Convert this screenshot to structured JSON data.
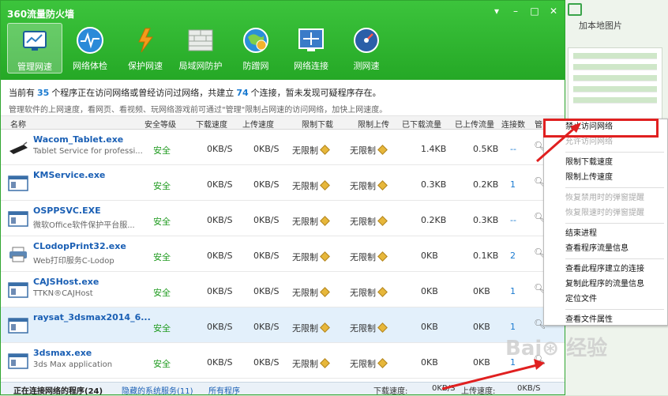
{
  "bg_right": {
    "label": "加本地图片"
  },
  "app": {
    "title": "360流量防火墙",
    "controls": [
      "▾",
      "–",
      "□",
      "✕"
    ]
  },
  "toolbar": [
    {
      "label": "管理网速",
      "icon": "monitor-icon",
      "active": true,
      "color": "#2e7fc4"
    },
    {
      "label": "网络体检",
      "icon": "pulse-icon",
      "active": false,
      "color": "#2a8ad8"
    },
    {
      "label": "保护网速",
      "icon": "lightning-shield-icon",
      "active": false,
      "color": "#f39b1a"
    },
    {
      "label": "局域网防护",
      "icon": "brick-wall-icon",
      "active": false,
      "color": "#d4dad4"
    },
    {
      "label": "防蹭网",
      "icon": "globe-icon",
      "active": false,
      "color": "#2b8fd8"
    },
    {
      "label": "网络连接",
      "icon": "network-screen-icon",
      "active": false,
      "color": "#3a7bc8"
    },
    {
      "label": "测网速",
      "icon": "speedometer-icon",
      "active": false,
      "color": "#2b5fa8"
    }
  ],
  "summary": {
    "p1": "当前有",
    "count_programs": "35",
    "p2": "个程序正在访问网络或曾经访问过网络，共建立",
    "count_conns": "74",
    "p3": "个连接，暂未发现可疑程序存在。",
    "line2": "管理软件的上网速度，看网页、看视频、玩网络游戏前可通过\"管理\"限制占网速的访问网络，加快上网速度。"
  },
  "columns": [
    "名称",
    "安全等级",
    "下载速度",
    "上传速度",
    "限制下载",
    "限制上传",
    "已下载流量",
    "已上传流量",
    "连接数",
    "管"
  ],
  "rows": [
    {
      "name": "Wacom_Tablet.exe",
      "desc": "Tablet Service for professi...",
      "icon": "tablet-icon",
      "safety": "安全",
      "down": "0KB/S",
      "up": "0KB/S",
      "limit_down": "无限制",
      "limit_up": "无限制",
      "downloaded": "1.4KB",
      "uploaded": "0.5KB",
      "conns": "--",
      "selected": false
    },
    {
      "name": "KMService.exe",
      "desc": "",
      "icon": "window-app-icon",
      "safety": "安全",
      "down": "0KB/S",
      "up": "0KB/S",
      "limit_down": "无限制",
      "limit_up": "无限制",
      "downloaded": "0.3KB",
      "uploaded": "0.2KB",
      "conns": "1",
      "selected": false
    },
    {
      "name": "OSPPSVC.EXE",
      "desc": "微软Office软件保护平台服...",
      "icon": "window-app-icon",
      "safety": "安全",
      "down": "0KB/S",
      "up": "0KB/S",
      "limit_down": "无限制",
      "limit_up": "无限制",
      "downloaded": "0.2KB",
      "uploaded": "0.3KB",
      "conns": "--",
      "selected": false
    },
    {
      "name": "CLodopPrint32.exe",
      "desc": "Web打印服务C-Lodop",
      "icon": "printer-icon",
      "safety": "安全",
      "down": "0KB/S",
      "up": "0KB/S",
      "limit_down": "无限制",
      "limit_up": "无限制",
      "downloaded": "0KB",
      "uploaded": "0.1KB",
      "conns": "2",
      "selected": false
    },
    {
      "name": "CAJSHost.exe",
      "desc": "TTKN®CAJHost",
      "icon": "window-app-icon",
      "safety": "安全",
      "down": "0KB/S",
      "up": "0KB/S",
      "limit_down": "无限制",
      "limit_up": "无限制",
      "downloaded": "0KB",
      "uploaded": "0KB",
      "conns": "1",
      "selected": false
    },
    {
      "name": "raysat_3dsmax2014_6...",
      "desc": "",
      "icon": "window-app-icon",
      "safety": "安全",
      "down": "0KB/S",
      "up": "0KB/S",
      "limit_down": "无限制",
      "limit_up": "无限制",
      "downloaded": "0KB",
      "uploaded": "0KB",
      "conns": "1",
      "selected": true
    },
    {
      "name": "3dsmax.exe",
      "desc": "3ds Max application",
      "icon": "window-app-icon",
      "safety": "安全",
      "down": "0KB/S",
      "up": "0KB/S",
      "limit_down": "无限制",
      "limit_up": "无限制",
      "downloaded": "0KB",
      "uploaded": "0KB",
      "conns": "1",
      "selected": false
    }
  ],
  "status": {
    "tab1": "正在连接网络的程序(24)",
    "tab2": "隐藏的系统服务(11)",
    "tab3": "所有程序",
    "down_label": "下载速度:",
    "down_val": "0KB/S",
    "up_label": "上传速度:",
    "up_val": "0KB/S"
  },
  "context_menu": [
    {
      "label": "禁止访问网络",
      "disabled": false
    },
    {
      "label": "允许访问网络",
      "disabled": true
    },
    {
      "sep": true
    },
    {
      "label": "限制下载速度",
      "disabled": false
    },
    {
      "label": "限制上传速度",
      "disabled": false
    },
    {
      "sep": true
    },
    {
      "label": "恢复禁用时的弹窗提醒",
      "disabled": true
    },
    {
      "label": "恢复限速时的弹窗提醒",
      "disabled": true
    },
    {
      "sep": true
    },
    {
      "label": "结束进程",
      "disabled": false
    },
    {
      "label": "查看程序流量信息",
      "disabled": false
    },
    {
      "sep": true
    },
    {
      "label": "查看此程序建立的连接",
      "disabled": false
    },
    {
      "label": "复制此程序的流量信息",
      "disabled": false
    },
    {
      "label": "定位文件",
      "disabled": false
    },
    {
      "sep": true
    },
    {
      "label": "查看文件属性",
      "disabled": false
    }
  ],
  "colors": {
    "highlight": "#e02020",
    "brand_green": "#2fb02f"
  }
}
